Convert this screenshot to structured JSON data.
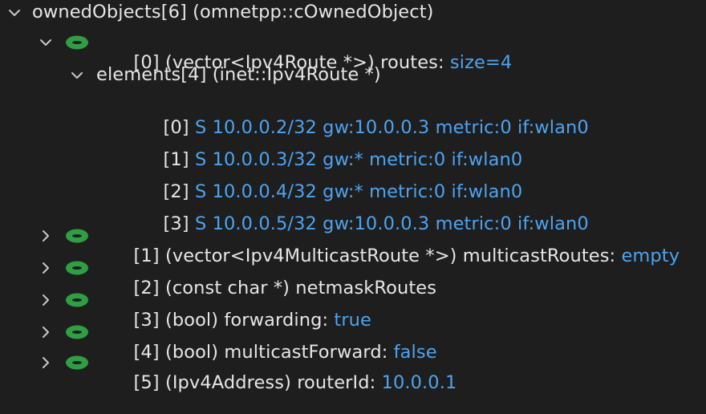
{
  "tree": {
    "root": {
      "label": "ownedObjects[6] (omnetpp::cOwnedObject)",
      "expanded": true,
      "icon": "chevron-down-icon"
    },
    "items": [
      {
        "label": "[0] (vector<Ipv4Route *>) routes: ",
        "value": "size=4",
        "expanded": true,
        "icon": "object-eye-icon",
        "chevron": "chevron-down-icon",
        "children": {
          "label": "elements[4] (inet::Ipv4Route *)",
          "expanded": true,
          "chevron": "chevron-down-icon",
          "entries": [
            {
              "index": "[0] ",
              "value": "S 10.0.0.2/32 gw:10.0.0.3 metric:0 if:wlan0"
            },
            {
              "index": "[1] ",
              "value": "S 10.0.0.3/32 gw:* metric:0 if:wlan0"
            },
            {
              "index": "[2] ",
              "value": "S 10.0.0.4/32 gw:* metric:0 if:wlan0"
            },
            {
              "index": "[3] ",
              "value": "S 10.0.0.5/32 gw:10.0.0.3 metric:0 if:wlan0"
            }
          ]
        }
      },
      {
        "label": "[1] (vector<Ipv4MulticastRoute *>) multicastRoutes: ",
        "value": "empty",
        "expanded": false,
        "icon": "object-eye-icon",
        "chevron": "chevron-right-icon"
      },
      {
        "label": "[2] (const char *) netmaskRoutes",
        "value": "",
        "expanded": false,
        "icon": "object-eye-icon",
        "chevron": "chevron-right-icon"
      },
      {
        "label": "[3] (bool) forwarding: ",
        "value": "true",
        "expanded": false,
        "icon": "object-eye-icon",
        "chevron": "chevron-right-icon"
      },
      {
        "label": "[4] (bool) multicastForward: ",
        "value": "false",
        "expanded": false,
        "icon": "object-eye-icon",
        "chevron": "chevron-right-icon"
      },
      {
        "label": "[5] (Ipv4Address) routerId: ",
        "value": "10.0.0.1",
        "expanded": false,
        "icon": "object-eye-icon",
        "chevron": "chevron-right-icon"
      }
    ]
  },
  "colors": {
    "background": "#1e1e1e",
    "text": "#e6e6e6",
    "value": "#4ea3f0",
    "icon_green": "#2f9e44",
    "chevron": "#c8c8c8"
  }
}
